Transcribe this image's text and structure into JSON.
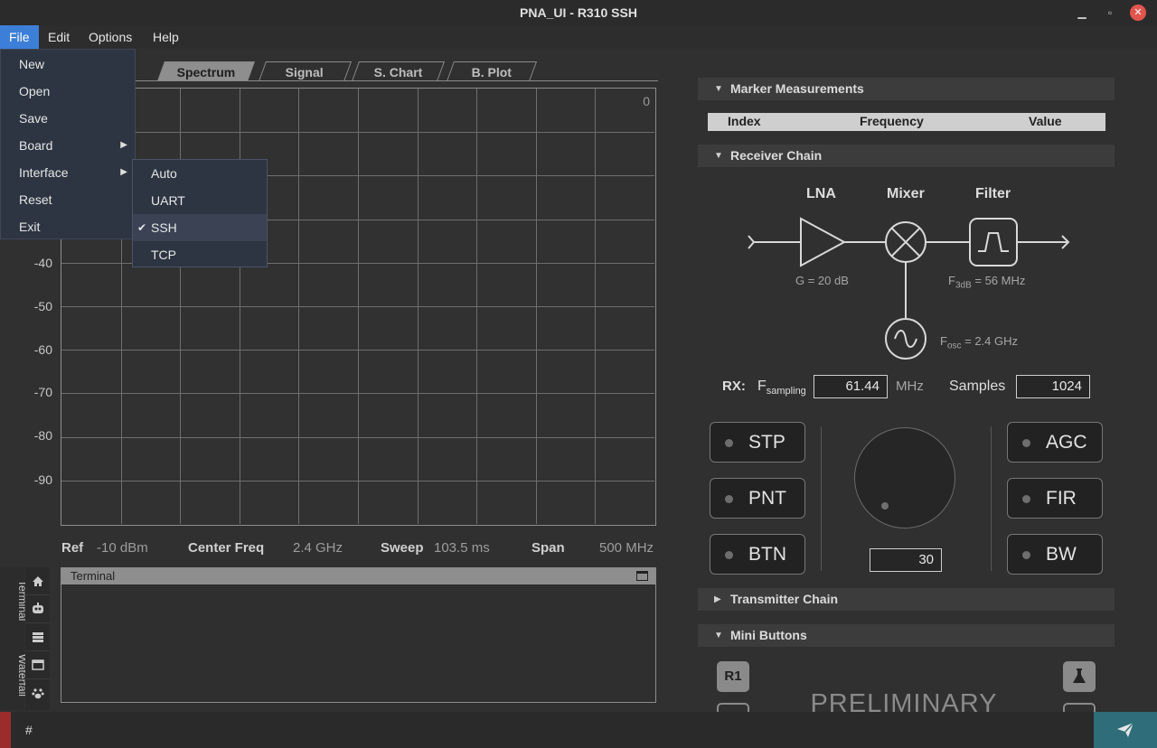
{
  "window": {
    "title": "PNA_UI - R310 SSH",
    "controls": [
      "minimize-icon",
      "restore-icon",
      "close-icon"
    ]
  },
  "menubar": {
    "items": [
      "File",
      "Edit",
      "Options",
      "Help"
    ]
  },
  "file_menu": {
    "items": [
      "New",
      "Open",
      "Save",
      "Board",
      "Interface",
      "Reset",
      "Exit"
    ]
  },
  "interface_menu": {
    "items": [
      "Auto",
      "UART",
      "SSH",
      "TCP"
    ],
    "checked": "SSH",
    "check_mark": "✔"
  },
  "tabs": [
    "Spectrum",
    "Signal",
    "S. Chart",
    "B. Plot"
  ],
  "plot": {
    "corner_value": "0",
    "y_ticks": [
      "-40",
      "-50",
      "-60",
      "-70",
      "-80",
      "-90"
    ],
    "grid_cols": 10,
    "grid_rows": 10
  },
  "stats": {
    "ref_label": "Ref",
    "ref_value": "-10 dBm",
    "center_label": "Center Freq",
    "center_value": "2.4 GHz",
    "sweep_label": "Sweep",
    "sweep_value": "103.5 ms",
    "span_label": "Span",
    "span_value": "500 MHz"
  },
  "side_tabs": {
    "terminal": "Terminal",
    "waterfall": "Waterfall"
  },
  "side_icons": [
    "home-icon",
    "robot-icon",
    "server-icon",
    "window-icon",
    "paw-icon"
  ],
  "terminal": {
    "title": "Terminal"
  },
  "cmd": {
    "prompt": "#"
  },
  "right": {
    "marker": {
      "header": "Marker Measurements",
      "col_index": "Index",
      "col_frequency": "Frequency",
      "col_value": "Value"
    },
    "receiver": {
      "header": "Receiver Chain",
      "lna": "LNA",
      "mixer": "Mixer",
      "filter": "Filter",
      "gain": "G = 20 dB",
      "f3db_prefix": "F",
      "f3db_sub": "3dB",
      "f3db_suffix": " = 56 MHz",
      "fosc_prefix": "F",
      "fosc_sub": "osc",
      "fosc_suffix": " = 2.4 GHz",
      "rx_label": "RX:",
      "fs_prefix": "F",
      "fs_sub": "sampling",
      "fs_value": "61.44",
      "fs_unit": "MHz",
      "samples_label": "Samples",
      "samples_value": "1024",
      "left_buttons": [
        "STP",
        "PNT",
        "BTN"
      ],
      "right_buttons": [
        "AGC",
        "FIR",
        "BW"
      ],
      "knob_value": "30"
    },
    "transmitter": {
      "header": "Transmitter Chain"
    },
    "mini": {
      "header": "Mini Buttons",
      "r1": "R1",
      "preliminary": "PRELIMINARY"
    }
  },
  "colors": {
    "accent": "#3d7fd8",
    "close": "#e0554c",
    "send": "#2f6d7a",
    "record": "#9a2c2c"
  }
}
